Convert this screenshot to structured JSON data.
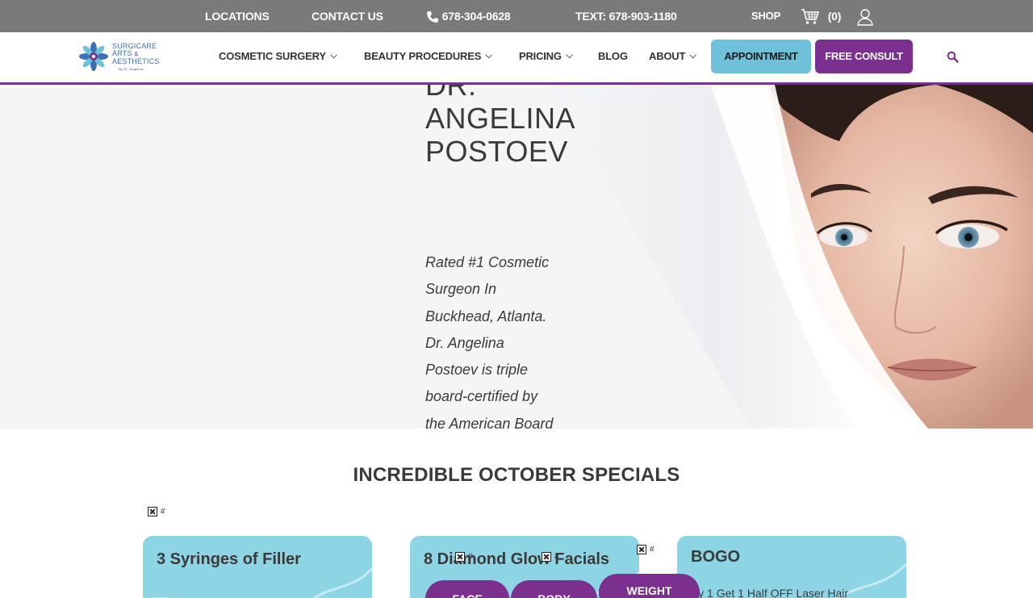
{
  "topbar": {
    "locations": "LOCATIONS",
    "contact": "CONTACT US",
    "phone": "678-304-0628",
    "text": "TEXT: 678-903-1180",
    "shop": "SHOP",
    "cart_count": "(0)"
  },
  "header": {
    "logo_line1": "SURGICARE",
    "logo_line2": "ARTS",
    "logo_amp": "&",
    "logo_line3": "AESTHETICS",
    "logo_sub": "By Dr. Angelina",
    "nav": {
      "cosmetic": "COSMETIC SURGERY",
      "beauty": "BEAUTY PROCEDURES",
      "pricing": "PRICING",
      "blog": "BLOG",
      "about": "ABOUT"
    },
    "appointment": "APPOINTMENT",
    "consult": "FREE CONSULT"
  },
  "hero": {
    "title": "DR. ANGELINA POSTOEV",
    "desc": "Rated #1 Cosmetic Surgeon In Buckhead, Atlanta. Dr. Angelina Postoev is triple board-certified by the American Board of Surgery and the American Academy of Cosmetic Surgery."
  },
  "specials": {
    "title": "INCREDIBLE OCTOBER SPECIALS",
    "hash": "#",
    "cards": [
      {
        "title": "3 Syringes of Filler"
      },
      {
        "title": "8 Diamond Glow Facials"
      },
      {
        "title": "BOGO",
        "desc": "Buy 1 Get 1 Half OFF Laser Hair"
      }
    ],
    "tabs": [
      "FACE",
      "BODY",
      "WEIGHT"
    ]
  },
  "colors": {
    "topbar": "#7a7a7a",
    "brand_purple": "#7b2f8e",
    "appointment_blue": "#6ec1d8",
    "card_blue": "#8dd5e4"
  }
}
